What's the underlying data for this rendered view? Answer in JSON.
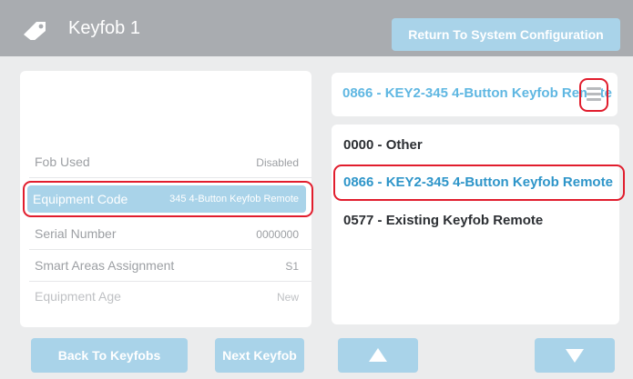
{
  "header": {
    "title": "Keyfob 1",
    "return_button": "Return To System Configuration",
    "icon": "tag-icon"
  },
  "details": {
    "rows": [
      {
        "label": "Fob Used",
        "value": "Disabled"
      },
      {
        "label": "Equipment Code",
        "value": "345 4-Button Keyfob Remote"
      },
      {
        "label": "Serial Number",
        "value": "0000000"
      },
      {
        "label": "Smart Areas Assignment",
        "value": "S1"
      },
      {
        "label": "Equipment Age",
        "value": "New"
      }
    ]
  },
  "selector": {
    "current": "0866 - KEY2-345 4-Button Keyfob Remote",
    "menu_icon": "hamburger-menu-icon"
  },
  "dropdown": {
    "options": [
      "0000 - Other",
      "0866 - KEY2-345 4-Button Keyfob Remote",
      "0577 - Existing Keyfob Remote"
    ]
  },
  "footer": {
    "back_button": "Back To Keyfobs",
    "next_button": "Next Keyfob",
    "up_icon": "arrow-up-icon",
    "down_icon": "arrow-down-icon"
  },
  "colors": {
    "accent": "#a9d3e9",
    "highlight_text": "#2e95c9",
    "annotation": "#e11d2d"
  }
}
